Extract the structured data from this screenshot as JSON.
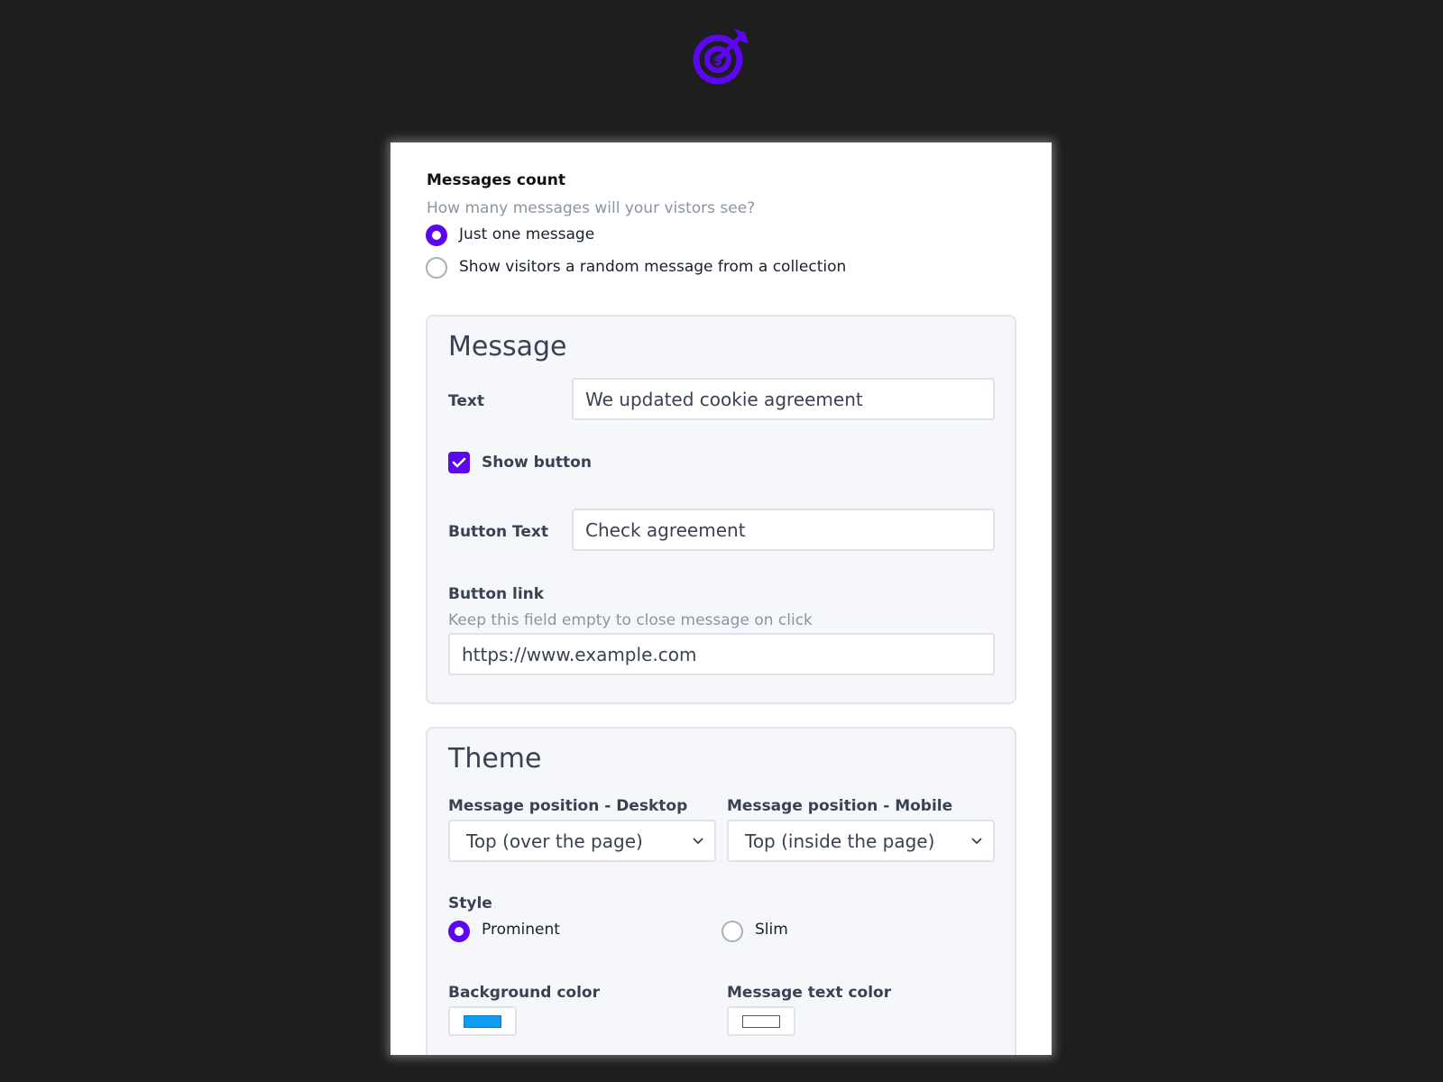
{
  "logo": {
    "icon": "target-arrow-dollar-icon",
    "color": "#5b08ef"
  },
  "messages_count": {
    "title": "Messages count",
    "hint": "How many messages will your vistors see?",
    "options": [
      {
        "label": "Just one message",
        "selected": true
      },
      {
        "label": "Show visitors a random message from a collection",
        "selected": false
      }
    ]
  },
  "message_panel": {
    "title": "Message",
    "text_label": "Text",
    "text_value": "We updated cookie agreement",
    "show_button_label": "Show button",
    "show_button_checked": true,
    "button_text_label": "Button Text",
    "button_text_value": "Check agreement",
    "button_link_label": "Button link",
    "button_link_hint": "Keep this field empty to close message on click",
    "button_link_value": "https://www.example.com"
  },
  "theme_panel": {
    "title": "Theme",
    "desktop_position_label": "Message position - Desktop",
    "desktop_position_value": "Top (over the page)",
    "mobile_position_label": "Message position - Mobile",
    "mobile_position_value": "Top (inside the page)",
    "style_label": "Style",
    "style_options": [
      {
        "label": "Prominent",
        "selected": true
      },
      {
        "label": "Slim",
        "selected": false
      }
    ],
    "background_color_label": "Background color",
    "background_color": "#0f9bf0",
    "text_color_label": "Message text color",
    "text_color": "#ffffff"
  },
  "colors": {
    "accent": "#5b08ef",
    "page_background": "#1e1e1f",
    "panel_background": "#f6f7fb"
  }
}
